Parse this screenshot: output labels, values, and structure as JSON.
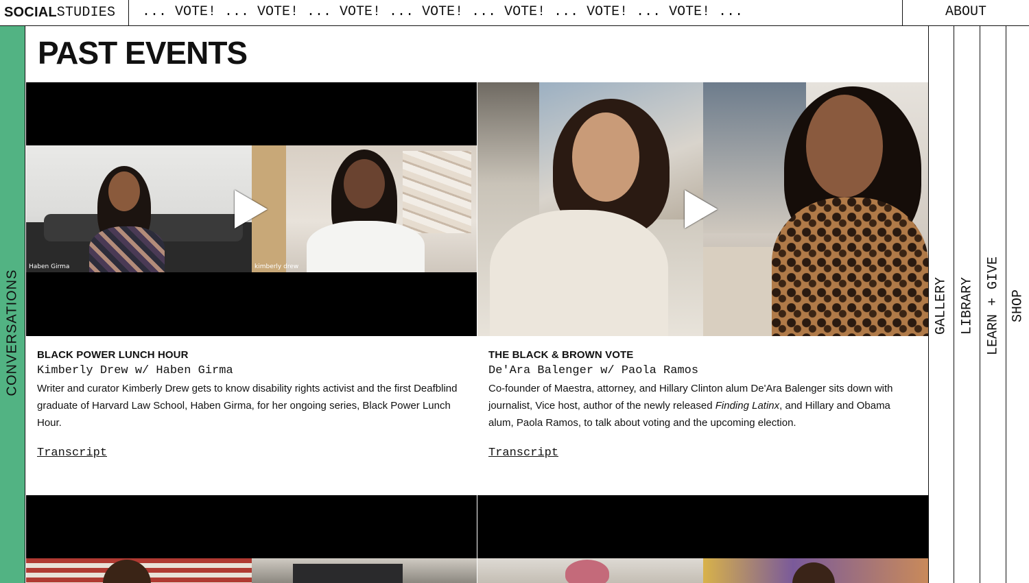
{
  "header": {
    "logo_bold": "SOCIAL",
    "logo_mono": "STUDIES",
    "ticker": "...  VOTE!  ...  VOTE!  ...  VOTE!  ...  VOTE!  ...  VOTE!  ...  VOTE!  ...  VOTE!  ...",
    "about_label": "ABOUT"
  },
  "left_nav": {
    "label": "CONVERSATIONS"
  },
  "right_nav": [
    {
      "label": "GALLERY"
    },
    {
      "label": "LIBRARY"
    },
    {
      "label": "LEARN + GIVE"
    },
    {
      "label": "SHOP"
    }
  ],
  "page": {
    "title": "PAST EVENTS"
  },
  "events": [
    {
      "title": "BLACK POWER LUNCH HOUR",
      "speakers": "Kimberly Drew w/ Haben Girma",
      "description": "Writer and curator Kimberly Drew gets to know disability rights activist and the first Deafblind graduate of Harvard Law School, Haben Girma, for her ongoing series, Black Power Lunch Hour.",
      "transcript_label": "Transcript",
      "video_captions": [
        "Haben Girma",
        "kimberly drew"
      ]
    },
    {
      "title": "THE BLACK & BROWN VOTE",
      "speakers": "De'Ara Balenger w/ Paola Ramos",
      "description_parts": [
        "Co-founder of Maestra, attorney, and Hillary Clinton alum De'Ara Balenger sits down with journalist, Vice host, author of the newly released ",
        "Finding Latinx",
        ", and Hillary and Obama alum, Paola Ramos, to talk about voting and the upcoming election."
      ],
      "transcript_label": "Transcript"
    }
  ],
  "colors": {
    "accent_green": "#52b383",
    "ink": "#111111",
    "video_bg": "#000000"
  }
}
